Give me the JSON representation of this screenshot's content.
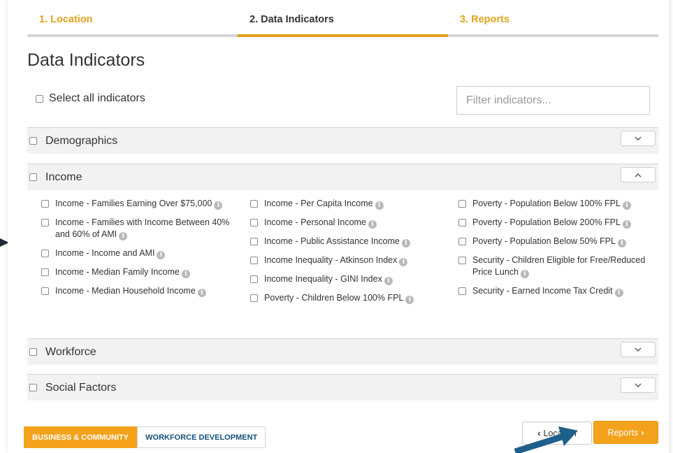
{
  "steps": [
    {
      "label": "1. Location"
    },
    {
      "label": "2. Data Indicators"
    },
    {
      "label": "3. Reports"
    }
  ],
  "page_title": "Data Indicators",
  "select_all_label": "Select all indicators",
  "filter_placeholder": "Filter indicators...",
  "sections": {
    "demographics": "Demographics",
    "income": "Income",
    "workforce": "Workforce",
    "social": "Social Factors"
  },
  "income_indicators": {
    "col1": [
      "Income - Families Earning Over $75,000",
      "Income - Families with Income Between 40% and 60% of AMI",
      "Income - Income and AMI",
      "Income - Median Family Income",
      "Income - Median Household Income"
    ],
    "col2": [
      "Income - Per Capita Income",
      "Income - Personal Income",
      "Income - Public Assistance Income",
      "Income Inequality - Atkinson Index",
      "Income Inequality - GINI Index",
      "Poverty - Children Below 100% FPL"
    ],
    "col3": [
      "Poverty - Population Below 100% FPL",
      "Poverty - Population Below 200% FPL",
      "Poverty - Population Below 50% FPL",
      "Security - Children Eligible for Free/Reduced Price Lunch",
      "Security - Earned Income Tax Credit"
    ]
  },
  "tabs": {
    "business": "BUSINESS & COMMUNITY",
    "workforce": "WORKFORCE DEVELOPMENT"
  },
  "buttons": {
    "location": "Location",
    "reports": "Reports"
  },
  "colors": {
    "accent": "#f4a11b",
    "navy": "#15507a",
    "arrow": "#1f5f8b"
  }
}
